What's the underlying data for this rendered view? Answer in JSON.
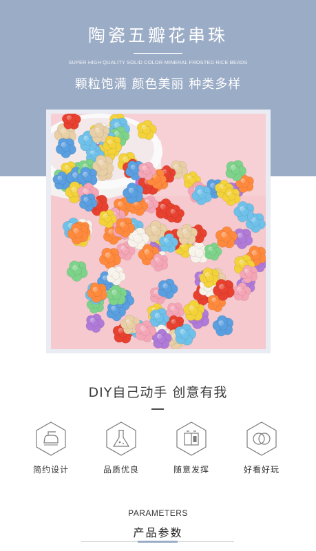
{
  "header": {
    "title": "陶瓷五瓣花串珠",
    "subtitle_en": "SUPER HIGH QUALITY SOLID COLOR MINERAL FROSTED RICE BEADS",
    "tagline": "颗粒饱满 颜色美丽 种类多样",
    "band_color": "#9bacc6"
  },
  "product_photo": {
    "background_color": "#f6c9cf",
    "bead_colors": [
      "#f3d23a",
      "#ff8a3d",
      "#e8412f",
      "#b07ad8",
      "#6fc1ea",
      "#7ed38a",
      "#f5a6b6",
      "#e9cfa6",
      "#5a9fe0",
      "#f7f2ea"
    ]
  },
  "diy": {
    "title": "DIY自己动手 创意有我"
  },
  "features": [
    {
      "icon": "iron-icon",
      "label": "简约设计"
    },
    {
      "icon": "flask-icon",
      "label": "品质优良"
    },
    {
      "icon": "palette-icon",
      "label": "随意发挥"
    },
    {
      "icon": "rings-icon",
      "label": "好看好玩"
    }
  ],
  "parameters": {
    "title_en": "PARAMETERS",
    "title_cn": "产品参数"
  }
}
